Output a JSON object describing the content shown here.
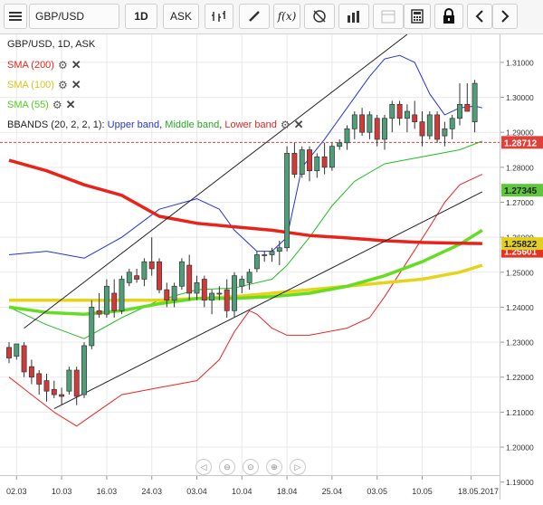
{
  "toolbar": {
    "symbol": "GBP/USD",
    "timeframe": "1D",
    "price_type": "ASK",
    "fx_label": "f(x)"
  },
  "legend": {
    "instrument": "GBP/USD, 1D, ASK",
    "sma200": "SMA (200)",
    "sma100": "SMA (100)",
    "sma55": "SMA (55)",
    "bbands_prefix": "BBANDS (20, 2, 2, 1): ",
    "upper": "Upper band",
    "middle": "Middle band",
    "lower": "Lower band"
  },
  "colors": {
    "sma200": "#e8241a",
    "sma100": "#e6d41b",
    "sma55": "#66dd22",
    "upper": "#2233dd",
    "middle": "#22bb22",
    "lower": "#ee2222",
    "bull": "#4f9e7a",
    "bear": "#d23a3a",
    "current_price_bg": "#e0403a",
    "sma55_tag_bg": "#5ec83a",
    "sma200_tag_bg": "#e6321f",
    "sma100_tag_bg": "#e2d021"
  },
  "price_tags": {
    "current": "1.28712",
    "sma55": "1.27345",
    "sma100": "1.25822",
    "sma200": "1.25601"
  },
  "chart_data": {
    "type": "candlestick",
    "ylim": [
      1.185,
      1.318
    ],
    "yticks": [
      "1.31000",
      "1.30000",
      "1.29000",
      "1.28000",
      "1.27000",
      "1.26000",
      "1.25000",
      "1.24000",
      "1.23000",
      "1.22000",
      "1.21000",
      "1.20000",
      "1.19000"
    ],
    "ytick_values": [
      1.31,
      1.3,
      1.29,
      1.28,
      1.27,
      1.26,
      1.25,
      1.24,
      1.23,
      1.22,
      1.21,
      1.2,
      1.19
    ],
    "xticks": [
      "02.03",
      "10.03",
      "16.03",
      "24.03",
      "03.04",
      "10.04",
      "18.04",
      "25.04",
      "03.05",
      "10.05",
      "18.05.2017"
    ],
    "xtick_index": [
      1,
      7,
      13,
      19,
      25,
      31,
      37,
      43,
      49,
      55,
      61.5
    ],
    "candles": [
      {
        "o": 1.2285,
        "h": 1.23,
        "l": 1.224,
        "c": 1.2255
      },
      {
        "o": 1.226,
        "h": 1.2295,
        "l": 1.225,
        "c": 1.2295
      },
      {
        "o": 1.229,
        "h": 1.23,
        "l": 1.22,
        "c": 1.2215
      },
      {
        "o": 1.223,
        "h": 1.225,
        "l": 1.218,
        "c": 1.22
      },
      {
        "o": 1.221,
        "h": 1.222,
        "l": 1.215,
        "c": 1.218
      },
      {
        "o": 1.219,
        "h": 1.221,
        "l": 1.213,
        "c": 1.216
      },
      {
        "o": 1.2165,
        "h": 1.219,
        "l": 1.214,
        "c": 1.215
      },
      {
        "o": 1.215,
        "h": 1.217,
        "l": 1.212,
        "c": 1.2145
      },
      {
        "o": 1.216,
        "h": 1.223,
        "l": 1.215,
        "c": 1.222
      },
      {
        "o": 1.222,
        "h": 1.223,
        "l": 1.212,
        "c": 1.2145
      },
      {
        "o": 1.215,
        "h": 1.23,
        "l": 1.214,
        "c": 1.229
      },
      {
        "o": 1.229,
        "h": 1.242,
        "l": 1.228,
        "c": 1.24
      },
      {
        "o": 1.239,
        "h": 1.244,
        "l": 1.237,
        "c": 1.238
      },
      {
        "o": 1.238,
        "h": 1.248,
        "l": 1.237,
        "c": 1.246
      },
      {
        "o": 1.244,
        "h": 1.248,
        "l": 1.237,
        "c": 1.239
      },
      {
        "o": 1.239,
        "h": 1.249,
        "l": 1.238,
        "c": 1.248
      },
      {
        "o": 1.247,
        "h": 1.251,
        "l": 1.246,
        "c": 1.25
      },
      {
        "o": 1.249,
        "h": 1.251,
        "l": 1.247,
        "c": 1.248
      },
      {
        "o": 1.248,
        "h": 1.254,
        "l": 1.246,
        "c": 1.253
      },
      {
        "o": 1.253,
        "h": 1.26,
        "l": 1.249,
        "c": 1.251
      },
      {
        "o": 1.253,
        "h": 1.254,
        "l": 1.244,
        "c": 1.245
      },
      {
        "o": 1.245,
        "h": 1.247,
        "l": 1.24,
        "c": 1.242
      },
      {
        "o": 1.242,
        "h": 1.247,
        "l": 1.24,
        "c": 1.246
      },
      {
        "o": 1.246,
        "h": 1.254,
        "l": 1.245,
        "c": 1.253
      },
      {
        "o": 1.252,
        "h": 1.255,
        "l": 1.242,
        "c": 1.244
      },
      {
        "o": 1.244,
        "h": 1.249,
        "l": 1.242,
        "c": 1.247
      },
      {
        "o": 1.248,
        "h": 1.249,
        "l": 1.24,
        "c": 1.242
      },
      {
        "o": 1.242,
        "h": 1.245,
        "l": 1.238,
        "c": 1.244
      },
      {
        "o": 1.244,
        "h": 1.246,
        "l": 1.242,
        "c": 1.244
      },
      {
        "o": 1.245,
        "h": 1.248,
        "l": 1.237,
        "c": 1.239
      },
      {
        "o": 1.239,
        "h": 1.25,
        "l": 1.237,
        "c": 1.249
      },
      {
        "o": 1.246,
        "h": 1.249,
        "l": 1.244,
        "c": 1.248
      },
      {
        "o": 1.247,
        "h": 1.251,
        "l": 1.245,
        "c": 1.25
      },
      {
        "o": 1.251,
        "h": 1.256,
        "l": 1.25,
        "c": 1.255
      },
      {
        "o": 1.255,
        "h": 1.256,
        "l": 1.253,
        "c": 1.255
      },
      {
        "o": 1.255,
        "h": 1.257,
        "l": 1.253,
        "c": 1.256
      },
      {
        "o": 1.256,
        "h": 1.259,
        "l": 1.252,
        "c": 1.257
      },
      {
        "o": 1.257,
        "h": 1.286,
        "l": 1.256,
        "c": 1.284
      },
      {
        "o": 1.284,
        "h": 1.287,
        "l": 1.277,
        "c": 1.278
      },
      {
        "o": 1.278,
        "h": 1.286,
        "l": 1.277,
        "c": 1.285
      },
      {
        "o": 1.285,
        "h": 1.286,
        "l": 1.276,
        "c": 1.279
      },
      {
        "o": 1.279,
        "h": 1.284,
        "l": 1.277,
        "c": 1.283
      },
      {
        "o": 1.283,
        "h": 1.287,
        "l": 1.278,
        "c": 1.28
      },
      {
        "o": 1.28,
        "h": 1.287,
        "l": 1.279,
        "c": 1.286
      },
      {
        "o": 1.286,
        "h": 1.288,
        "l": 1.285,
        "c": 1.287
      },
      {
        "o": 1.287,
        "h": 1.292,
        "l": 1.285,
        "c": 1.291
      },
      {
        "o": 1.291,
        "h": 1.296,
        "l": 1.288,
        "c": 1.295
      },
      {
        "o": 1.295,
        "h": 1.297,
        "l": 1.289,
        "c": 1.29
      },
      {
        "o": 1.29,
        "h": 1.296,
        "l": 1.288,
        "c": 1.295
      },
      {
        "o": 1.294,
        "h": 1.295,
        "l": 1.286,
        "c": 1.288
      },
      {
        "o": 1.288,
        "h": 1.295,
        "l": 1.285,
        "c": 1.294
      },
      {
        "o": 1.294,
        "h": 1.299,
        "l": 1.29,
        "c": 1.298
      },
      {
        "o": 1.298,
        "h": 1.299,
        "l": 1.292,
        "c": 1.294
      },
      {
        "o": 1.294,
        "h": 1.298,
        "l": 1.29,
        "c": 1.296
      },
      {
        "o": 1.295,
        "h": 1.299,
        "l": 1.291,
        "c": 1.293
      },
      {
        "o": 1.293,
        "h": 1.296,
        "l": 1.286,
        "c": 1.289
      },
      {
        "o": 1.289,
        "h": 1.296,
        "l": 1.288,
        "c": 1.295
      },
      {
        "o": 1.295,
        "h": 1.296,
        "l": 1.287,
        "c": 1.288
      },
      {
        "o": 1.289,
        "h": 1.293,
        "l": 1.286,
        "c": 1.291
      },
      {
        "o": 1.291,
        "h": 1.295,
        "l": 1.288,
        "c": 1.294
      },
      {
        "o": 1.294,
        "h": 1.304,
        "l": 1.292,
        "c": 1.298
      },
      {
        "o": 1.298,
        "h": 1.304,
        "l": 1.296,
        "c": 1.296
      },
      {
        "o": 1.293,
        "h": 1.305,
        "l": 1.29,
        "c": 1.304
      }
    ],
    "series": [
      {
        "name": "SMA (200)",
        "values": [
          [
            0,
            1.282
          ],
          [
            5,
            1.279
          ],
          [
            10,
            1.275
          ],
          [
            15,
            1.272
          ],
          [
            20,
            1.266
          ],
          [
            25,
            1.264
          ],
          [
            30,
            1.263
          ],
          [
            35,
            1.262
          ],
          [
            40,
            1.2605
          ],
          [
            45,
            1.2598
          ],
          [
            50,
            1.259
          ],
          [
            55,
            1.2585
          ],
          [
            60,
            1.2583
          ],
          [
            63,
            1.2582
          ]
        ]
      },
      {
        "name": "SMA (100)",
        "values": [
          [
            0,
            1.242
          ],
          [
            10,
            1.242
          ],
          [
            20,
            1.242
          ],
          [
            25,
            1.2425
          ],
          [
            30,
            1.243
          ],
          [
            35,
            1.244
          ],
          [
            40,
            1.245
          ],
          [
            45,
            1.246
          ],
          [
            50,
            1.247
          ],
          [
            55,
            1.248
          ],
          [
            60,
            1.25
          ],
          [
            63,
            1.252
          ]
        ]
      },
      {
        "name": "SMA (55)",
        "values": [
          [
            0,
            1.24
          ],
          [
            5,
            1.2385
          ],
          [
            10,
            1.238
          ],
          [
            15,
            1.239
          ],
          [
            20,
            1.241
          ],
          [
            25,
            1.2425
          ],
          [
            30,
            1.2425
          ],
          [
            35,
            1.243
          ],
          [
            40,
            1.244
          ],
          [
            45,
            1.246
          ],
          [
            50,
            1.249
          ],
          [
            55,
            1.253
          ],
          [
            60,
            1.258
          ],
          [
            63,
            1.262
          ]
        ]
      },
      {
        "name": "Upper band",
        "values": [
          [
            0,
            1.255
          ],
          [
            5,
            1.256
          ],
          [
            10,
            1.254
          ],
          [
            15,
            1.26
          ],
          [
            20,
            1.268
          ],
          [
            25,
            1.271
          ],
          [
            28,
            1.268
          ],
          [
            30,
            1.262
          ],
          [
            33,
            1.256
          ],
          [
            35,
            1.256
          ],
          [
            37,
            1.26
          ],
          [
            39,
            1.28
          ],
          [
            42,
            1.288
          ],
          [
            45,
            1.297
          ],
          [
            48,
            1.306
          ],
          [
            50,
            1.311
          ],
          [
            52,
            1.312
          ],
          [
            54,
            1.31
          ],
          [
            56,
            1.301
          ],
          [
            58,
            1.295
          ],
          [
            60,
            1.297
          ],
          [
            62,
            1.2975
          ],
          [
            63,
            1.297
          ]
        ]
      },
      {
        "name": "Middle band",
        "values": [
          [
            0,
            1.24
          ],
          [
            5,
            1.235
          ],
          [
            10,
            1.231
          ],
          [
            15,
            1.237
          ],
          [
            20,
            1.242
          ],
          [
            25,
            1.245
          ],
          [
            30,
            1.2455
          ],
          [
            35,
            1.248
          ],
          [
            37,
            1.252
          ],
          [
            40,
            1.26
          ],
          [
            43,
            1.269
          ],
          [
            46,
            1.276
          ],
          [
            50,
            1.281
          ],
          [
            55,
            1.283
          ],
          [
            60,
            1.285
          ],
          [
            63,
            1.2875
          ]
        ]
      },
      {
        "name": "Lower band",
        "values": [
          [
            0,
            1.22
          ],
          [
            3,
            1.215
          ],
          [
            6,
            1.21
          ],
          [
            9,
            1.206
          ],
          [
            11,
            1.209
          ],
          [
            15,
            1.215
          ],
          [
            20,
            1.217
          ],
          [
            25,
            1.219
          ],
          [
            28,
            1.225
          ],
          [
            30,
            1.233
          ],
          [
            32,
            1.239
          ],
          [
            33,
            1.238
          ],
          [
            35,
            1.234
          ],
          [
            37,
            1.232
          ],
          [
            40,
            1.232
          ],
          [
            45,
            1.234
          ],
          [
            48,
            1.237
          ],
          [
            50,
            1.243
          ],
          [
            53,
            1.253
          ],
          [
            56,
            1.263
          ],
          [
            58,
            1.27
          ],
          [
            60,
            1.275
          ],
          [
            63,
            1.278
          ]
        ]
      }
    ],
    "trendlines": [
      {
        "from": [
          2,
          1.234
        ],
        "to": [
          53,
          1.318
        ]
      },
      {
        "from": [
          6,
          1.211
        ],
        "to": [
          63,
          1.273
        ]
      }
    ],
    "current_price": 1.28712
  }
}
